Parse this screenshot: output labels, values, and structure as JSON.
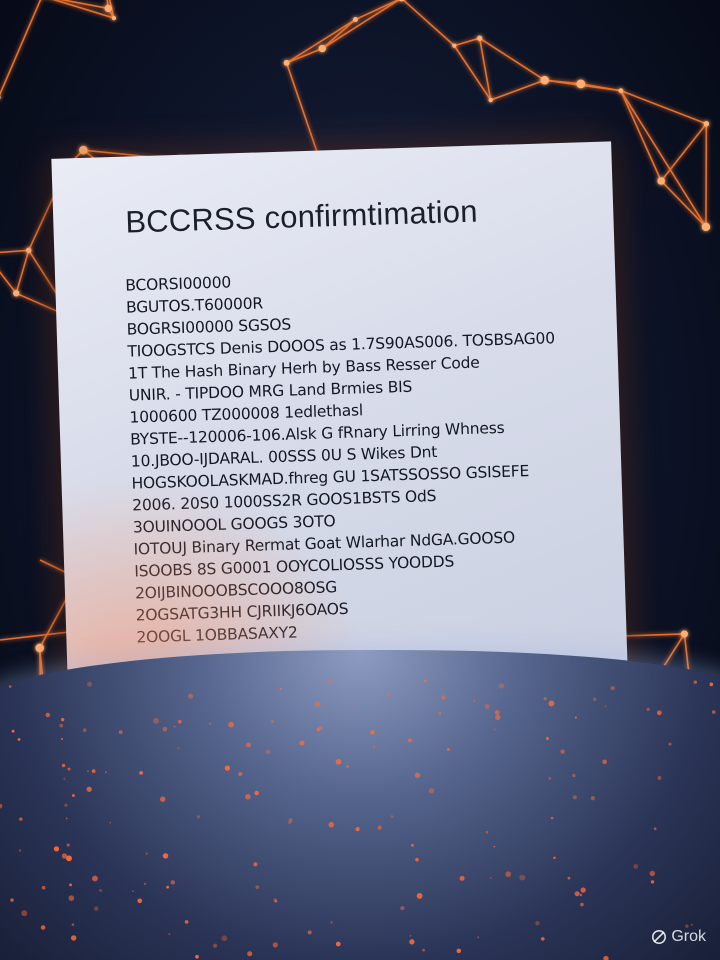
{
  "document": {
    "title": "BCCRSS confirmtimation",
    "lines": [
      "BCORSI00000",
      "BGUTOS.T60000R",
      "BOGRSI00000 SGSOS",
      "TIOOGSTCS Denis DOOOS as 1.7S90AS006. TOSBSAG00",
      "1T The Hash Binary Herh by Bass Resser Code",
      "UNIR. - TIPDOO MRG Land Brmies BIS",
      "1000600 TZ000008 1edlethasl",
      "BYSTE--120006-106.Alsk G fRnary Lirring Whness",
      "10.JBOO-IJDARAL. 00SSS 0U S Wikes Dnt",
      "HOGSKOOLASKMAD.fhreg GU 1SATSSOSSO GSISEFE",
      "2006. 20S0 1000SS2R GOOS1BSTS OdS",
      "3OUINOOOL GOOGS 3OTO",
      "IOTOUJ Binary Rermat Goat Wlarhar NdGA.GOOSO",
      "ISOOBS 8S G0001 OOYCOLIOSSS YOODDS",
      "2OIJBINOOOBSCOOO8OSG",
      "2OGSATG3HH CJRIIKJ6OAOS",
      "2OOGL 1OBBASAXY2"
    ]
  },
  "watermark": {
    "label": "Grok",
    "icon": "grok-logo-icon"
  },
  "colors": {
    "network_glow": "#ff7a2e",
    "background": "#0d1428",
    "paper": "#e2e6f0",
    "ground": "#4a5a82"
  }
}
